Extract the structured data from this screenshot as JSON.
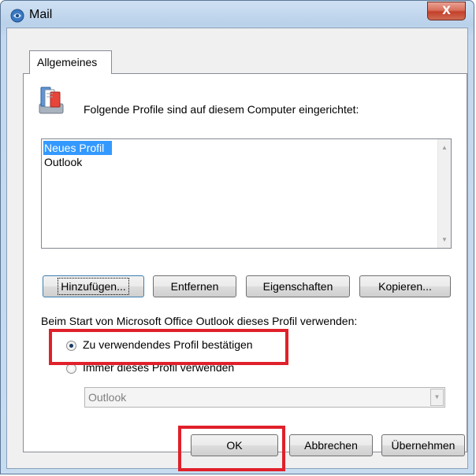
{
  "window": {
    "title": "Mail",
    "close_glyph": "X"
  },
  "tabs": [
    {
      "label": "Allgemeines",
      "active": true
    }
  ],
  "profiles": {
    "intro_label": "Folgende Profile sind auf diesem Computer eingerichtet:",
    "items": [
      {
        "label": "Neues Profil",
        "selected": true
      },
      {
        "label": "Outlook",
        "selected": false
      }
    ]
  },
  "buttons": {
    "add": "Hinzufügen...",
    "remove": "Entfernen",
    "properties": "Eigenschaften",
    "copy": "Kopieren..."
  },
  "startup": {
    "label": "Beim Start von Microsoft Office Outlook dieses Profil verwenden:",
    "options": [
      {
        "label": "Zu verwendendes Profil bestätigen",
        "checked": true
      },
      {
        "label": "Immer dieses Profil verwenden",
        "checked": false
      }
    ],
    "profile_select_value": "Outlook"
  },
  "footer": {
    "ok": "OK",
    "cancel": "Abbrechen",
    "apply": "Übernehmen"
  },
  "icons": [
    "mail-icon",
    "close-icon",
    "profiles-icon",
    "scroll-up-icon",
    "scroll-down-icon",
    "dropdown-arrow-icon"
  ],
  "colors": {
    "selection": "#3399ff",
    "annotation": "#e0202a",
    "close_button": "#c4402a"
  }
}
